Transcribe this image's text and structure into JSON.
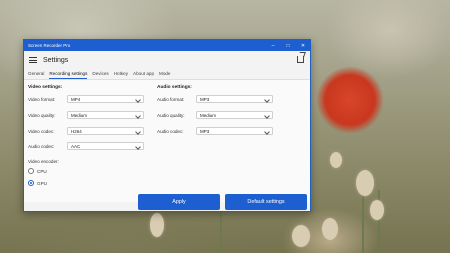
{
  "window": {
    "title": "Screen Recorder Pro"
  },
  "header": {
    "title": "Settings"
  },
  "tabs": [
    {
      "label": "General"
    },
    {
      "label": "Recording settings"
    },
    {
      "label": "Devices"
    },
    {
      "label": "Hotkey"
    },
    {
      "label": "About app"
    },
    {
      "label": "Mode"
    }
  ],
  "video": {
    "section_title": "Video settings:",
    "format_label": "Video format:",
    "format_value": "MP4",
    "quality_label": "Video quality:",
    "quality_value": "Medium",
    "codec_label": "Video codec:",
    "codec_value": "H264",
    "audio_codec_label": "Audio codec:",
    "audio_codec_value": "AAC"
  },
  "audio": {
    "section_title": "Audio settings:",
    "format_label": "Audio format:",
    "format_value": "MP3",
    "quality_label": "Audio quality:",
    "quality_value": "Medium",
    "codec_label": "Audio codec:",
    "codec_value": "MP3"
  },
  "encoder": {
    "label": "Video encoder:",
    "options": [
      {
        "label": "CPU",
        "selected": false
      },
      {
        "label": "GPU",
        "selected": true
      }
    ]
  },
  "buttons": {
    "apply": "Apply",
    "defaults": "Default settings"
  },
  "window_controls": {
    "minimize": "–",
    "maximize": "□",
    "close": "✕"
  },
  "colors": {
    "accent": "#1d5fd0",
    "poppy": "#d8452a"
  }
}
